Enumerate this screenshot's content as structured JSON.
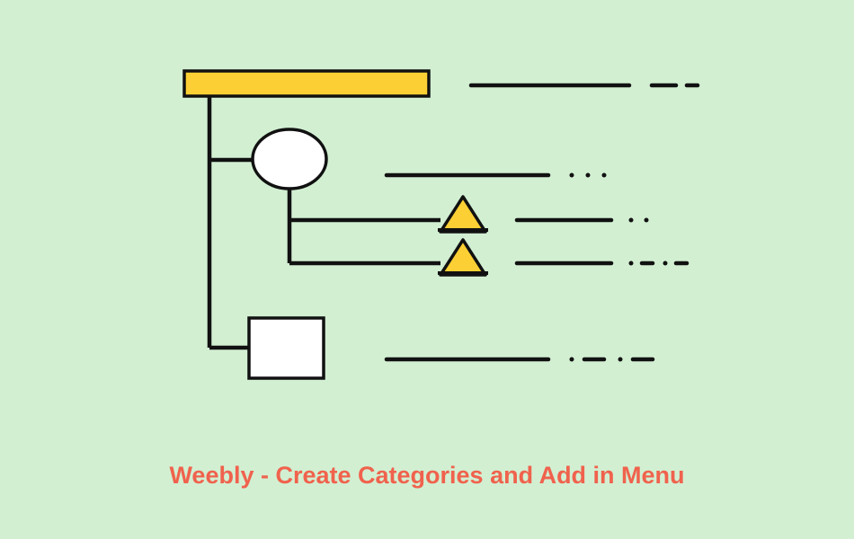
{
  "caption": "Weebly - Create Categories and Add in Menu",
  "colors": {
    "background": "#d2efd2",
    "fill_yellow": "#fcd034",
    "fill_white": "#ffffff",
    "stroke": "#111111",
    "caption": "#f0624d"
  },
  "diagram": {
    "description": "Hierarchical sitemap/menu structure",
    "nodes": [
      {
        "id": "root",
        "shape": "rectangle-wide",
        "fill": "yellow",
        "level": 0
      },
      {
        "id": "child-circle",
        "shape": "ellipse",
        "fill": "white",
        "level": 1
      },
      {
        "id": "grandchild-1",
        "shape": "triangle",
        "fill": "yellow",
        "level": 2
      },
      {
        "id": "grandchild-2",
        "shape": "triangle",
        "fill": "yellow",
        "level": 2
      },
      {
        "id": "child-square",
        "shape": "square",
        "fill": "white",
        "level": 1
      }
    ],
    "text_lines": [
      {
        "attached_to": "root",
        "style": "solid-with-dashes"
      },
      {
        "attached_to": "child-circle",
        "style": "solid-with-dots"
      },
      {
        "attached_to": "grandchild-1",
        "style": "solid-with-dots"
      },
      {
        "attached_to": "grandchild-2",
        "style": "solid-with-dot-dashes"
      },
      {
        "attached_to": "child-square",
        "style": "solid-with-dot-dashes"
      }
    ]
  }
}
